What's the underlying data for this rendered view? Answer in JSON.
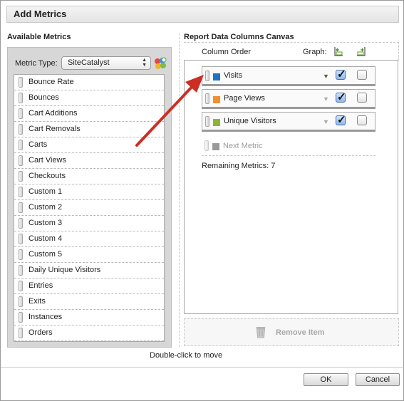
{
  "dialog": {
    "title": "Add Metrics"
  },
  "available": {
    "heading": "Available Metrics",
    "metric_type_label": "Metric Type:",
    "metric_type_value": "SiteCatalyst",
    "items": [
      "Bounce Rate",
      "Bounces",
      "Cart Additions",
      "Cart Removals",
      "Carts",
      "Cart Views",
      "Checkouts",
      "Custom 1",
      "Custom 2",
      "Custom 3",
      "Custom 4",
      "Custom 5",
      "Daily Unique Visitors",
      "Entries",
      "Exits",
      "Instances",
      "Orders"
    ]
  },
  "canvas": {
    "heading": "Report Data Columns Canvas",
    "column_order_label": "Column Order",
    "graph_label": "Graph:",
    "columns": [
      {
        "label": "Visits",
        "color": "#1f73c4",
        "graph_checked": true,
        "checked2": false,
        "tri_color": "#4a6a2a"
      },
      {
        "label": "Page Views",
        "color": "#f0912a",
        "graph_checked": true,
        "checked2": false,
        "tri_color": "#a8a8a8"
      },
      {
        "label": "Unique Visitors",
        "color": "#8cb43c",
        "graph_checked": true,
        "checked2": false,
        "tri_color": "#a8a8a8"
      }
    ],
    "next_metric": "Next Metric",
    "remaining": "Remaining Metrics: 7",
    "remove_item": "Remove Item"
  },
  "hint": "Double-click to move",
  "buttons": {
    "ok": "OK",
    "cancel": "Cancel"
  }
}
